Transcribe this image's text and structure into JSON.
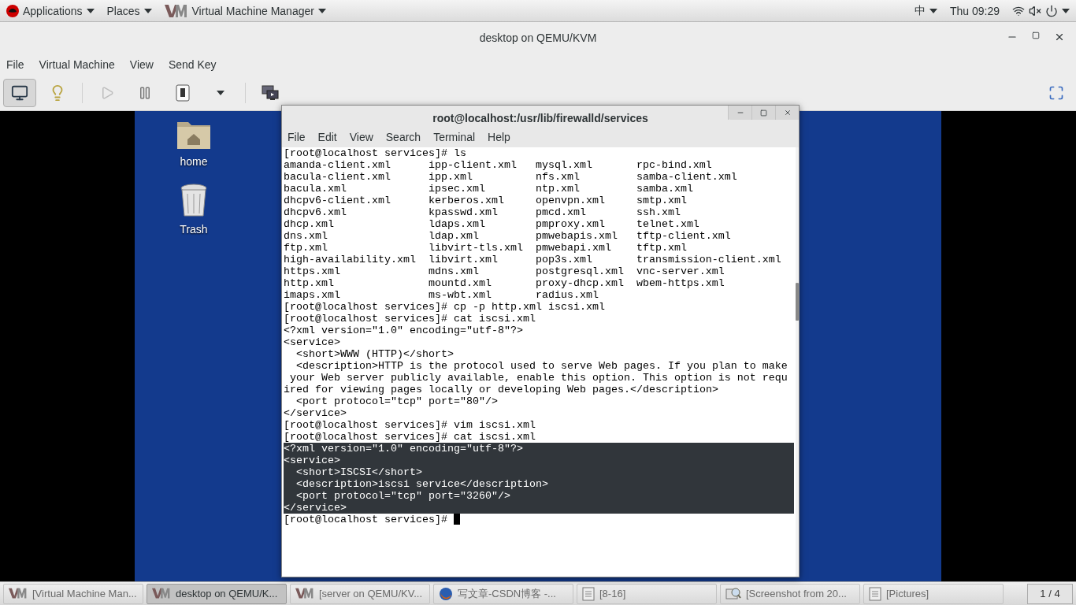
{
  "top_bar": {
    "menus": [
      {
        "kind": "redhat",
        "label": "Applications"
      },
      {
        "kind": "plain",
        "label": "Places"
      },
      {
        "kind": "vmm",
        "label": "Virtual Machine Manager"
      }
    ],
    "input_method": "中",
    "clock": "Thu 09:29"
  },
  "window": {
    "title": "desktop on QEMU/KVM",
    "menu": [
      "File",
      "Virtual Machine",
      "View",
      "Send Key"
    ],
    "toolbar": [
      {
        "kind": "console",
        "selected": true,
        "disabled": false
      },
      {
        "kind": "details",
        "selected": false,
        "disabled": false
      },
      {
        "kind": "run",
        "selected": false,
        "disabled": true
      },
      {
        "kind": "pause",
        "selected": false,
        "disabled": false
      },
      {
        "kind": "shutdown",
        "selected": false,
        "disabled": false
      },
      {
        "kind": "menu",
        "selected": false,
        "disabled": false
      },
      {
        "kind": "screens",
        "selected": false,
        "disabled": false
      }
    ]
  },
  "desktop_icons": [
    {
      "kind": "folder",
      "label": "home"
    },
    {
      "kind": "trash",
      "label": "Trash"
    }
  ],
  "terminal": {
    "title": "root@localhost:/usr/lib/firewalld/services",
    "menu": [
      "File",
      "Edit",
      "View",
      "Search",
      "Terminal",
      "Help"
    ],
    "cursor": true,
    "lines": [
      {
        "kind": "text",
        "highlighted": false,
        "text": "[root@localhost services]# ls"
      },
      {
        "kind": "columns",
        "highlighted": false,
        "cells": [
          "amanda-client.xml",
          "ipp-client.xml",
          "mysql.xml",
          "rpc-bind.xml"
        ]
      },
      {
        "kind": "columns",
        "highlighted": false,
        "cells": [
          "bacula-client.xml",
          "ipp.xml",
          "nfs.xml",
          "samba-client.xml"
        ]
      },
      {
        "kind": "columns",
        "highlighted": false,
        "cells": [
          "bacula.xml",
          "ipsec.xml",
          "ntp.xml",
          "samba.xml"
        ]
      },
      {
        "kind": "columns",
        "highlighted": false,
        "cells": [
          "dhcpv6-client.xml",
          "kerberos.xml",
          "openvpn.xml",
          "smtp.xml"
        ]
      },
      {
        "kind": "columns",
        "highlighted": false,
        "cells": [
          "dhcpv6.xml",
          "kpasswd.xml",
          "pmcd.xml",
          "ssh.xml"
        ]
      },
      {
        "kind": "columns",
        "highlighted": false,
        "cells": [
          "dhcp.xml",
          "ldaps.xml",
          "pmproxy.xml",
          "telnet.xml"
        ]
      },
      {
        "kind": "columns",
        "highlighted": false,
        "cells": [
          "dns.xml",
          "ldap.xml",
          "pmwebapis.xml",
          "tftp-client.xml"
        ]
      },
      {
        "kind": "columns",
        "highlighted": false,
        "cells": [
          "ftp.xml",
          "libvirt-tls.xml",
          "pmwebapi.xml",
          "tftp.xml"
        ]
      },
      {
        "kind": "columns",
        "highlighted": false,
        "cells": [
          "high-availability.xml",
          "libvirt.xml",
          "pop3s.xml",
          "transmission-client.xml"
        ]
      },
      {
        "kind": "columns",
        "highlighted": false,
        "cells": [
          "https.xml",
          "mdns.xml",
          "postgresql.xml",
          "vnc-server.xml"
        ]
      },
      {
        "kind": "columns",
        "highlighted": false,
        "cells": [
          "http.xml",
          "mountd.xml",
          "proxy-dhcp.xml",
          "wbem-https.xml"
        ]
      },
      {
        "kind": "columns",
        "highlighted": false,
        "cells": [
          "imaps.xml",
          "ms-wbt.xml",
          "radius.xml"
        ]
      },
      {
        "kind": "text",
        "highlighted": false,
        "text": "[root@localhost services]# cp -p http.xml iscsi.xml"
      },
      {
        "kind": "text",
        "highlighted": false,
        "text": "[root@localhost services]# cat iscsi.xml"
      },
      {
        "kind": "text",
        "highlighted": false,
        "text": "<?xml version=\"1.0\" encoding=\"utf-8\"?>"
      },
      {
        "kind": "text",
        "highlighted": false,
        "text": "<service>"
      },
      {
        "kind": "text",
        "highlighted": false,
        "text": "  <short>WWW (HTTP)</short>"
      },
      {
        "kind": "text",
        "highlighted": false,
        "text": "  <description>HTTP is the protocol used to serve Web pages. If you plan to make"
      },
      {
        "kind": "text",
        "highlighted": false,
        "text": " your Web server publicly available, enable this option. This option is not requ"
      },
      {
        "kind": "text",
        "highlighted": false,
        "text": "ired for viewing pages locally or developing Web pages.</description>"
      },
      {
        "kind": "text",
        "highlighted": false,
        "text": "  <port protocol=\"tcp\" port=\"80\"/>"
      },
      {
        "kind": "text",
        "highlighted": false,
        "text": "</service>"
      },
      {
        "kind": "text",
        "highlighted": false,
        "text": "[root@localhost services]# vim iscsi.xml"
      },
      {
        "kind": "text",
        "highlighted": false,
        "text": "[root@localhost services]# cat iscsi.xml"
      },
      {
        "kind": "text",
        "highlighted": true,
        "text": "<?xml version=\"1.0\" encoding=\"utf-8\"?>"
      },
      {
        "kind": "text",
        "highlighted": true,
        "text": "<service>"
      },
      {
        "kind": "text",
        "highlighted": true,
        "text": "  <short>ISCSI</short>"
      },
      {
        "kind": "text",
        "highlighted": true,
        "text": "  <description>iscsi service</description>"
      },
      {
        "kind": "text",
        "highlighted": true,
        "text": "  <port protocol=\"tcp\" port=\"3260\"/>"
      },
      {
        "kind": "text",
        "highlighted": true,
        "text": "</service>"
      },
      {
        "kind": "text",
        "highlighted": false,
        "text": "[root@localhost services]# "
      }
    ]
  },
  "taskbar": {
    "items": [
      {
        "kind": "vmm",
        "label": "[Virtual Machine Man...",
        "selected": false
      },
      {
        "kind": "vmm",
        "label": "desktop on QEMU/K...",
        "selected": true
      },
      {
        "kind": "vmm",
        "label": "[server on QEMU/KV...",
        "selected": false
      },
      {
        "kind": "browser",
        "label": "写文章-CSDN博客 -...",
        "selected": false
      },
      {
        "kind": "document",
        "label": "[8-16]",
        "selected": false
      },
      {
        "kind": "viewer",
        "label": "[Screenshot from 20...",
        "selected": false
      },
      {
        "kind": "document",
        "label": "[Pictures]",
        "selected": false
      }
    ],
    "pager": "1 / 4"
  }
}
